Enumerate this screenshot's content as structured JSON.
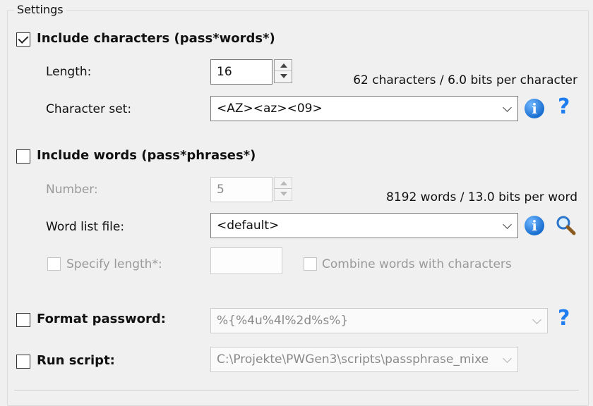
{
  "settings": {
    "title": "Settings",
    "characters": {
      "checkbox_label": "Include characters (pass*words*)",
      "checked": true,
      "length_label": "Length:",
      "length_value": "16",
      "info_text": "62 characters / 6.0 bits per character",
      "charset_label": "Character set:",
      "charset_value": "<AZ><az><09>"
    },
    "words": {
      "checkbox_label": "Include words (pass*phrases*)",
      "checked": false,
      "number_label": "Number:",
      "number_value": "5",
      "info_text": "8192 words / 13.0 bits per word",
      "wordlist_label": "Word list file:",
      "wordlist_value": "<default>",
      "specify_length_label": "Specify length*:",
      "specify_length_value": "",
      "combine_label": "Combine words with characters"
    },
    "format": {
      "checkbox_label": "Format password:",
      "checked": false,
      "value": "%{%4u%4l%2d%s%}"
    },
    "script": {
      "checkbox_label": "Run script:",
      "checked": false,
      "value": "C:\\Projekte\\PWGen3\\scripts\\passphrase_mixe"
    }
  },
  "icons": {
    "info": "info-icon",
    "help": "help-icon",
    "search": "search-icon"
  },
  "colors": {
    "accent_blue": "#1a6fd0",
    "disabled_text": "#9a9a9a"
  }
}
